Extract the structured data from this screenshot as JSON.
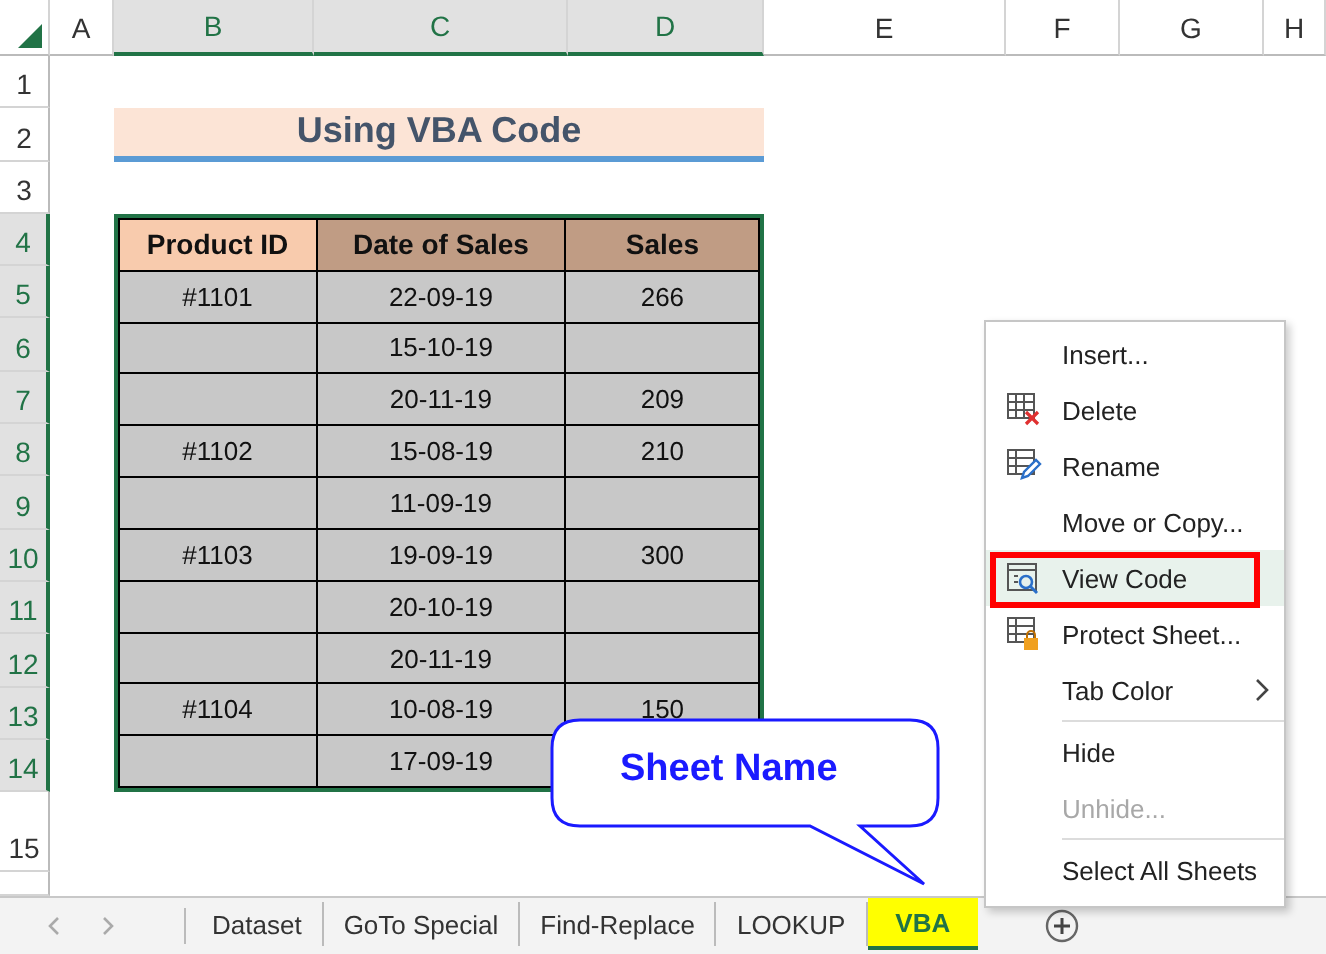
{
  "columns": [
    {
      "label": "A",
      "selected": false
    },
    {
      "label": "B",
      "selected": true
    },
    {
      "label": "C",
      "selected": true
    },
    {
      "label": "D",
      "selected": true
    },
    {
      "label": "E",
      "selected": false
    },
    {
      "label": "F",
      "selected": false
    },
    {
      "label": "G",
      "selected": false
    },
    {
      "label": "H",
      "selected": false
    }
  ],
  "rows": [
    {
      "label": "1",
      "selected": false
    },
    {
      "label": "2",
      "selected": false
    },
    {
      "label": "3",
      "selected": false
    },
    {
      "label": "4",
      "selected": true
    },
    {
      "label": "5",
      "selected": true
    },
    {
      "label": "6",
      "selected": true
    },
    {
      "label": "7",
      "selected": true
    },
    {
      "label": "8",
      "selected": true
    },
    {
      "label": "9",
      "selected": true
    },
    {
      "label": "10",
      "selected": true
    },
    {
      "label": "11",
      "selected": true
    },
    {
      "label": "12",
      "selected": true
    },
    {
      "label": "13",
      "selected": true
    },
    {
      "label": "14",
      "selected": true
    },
    {
      "label": "15",
      "selected": false
    }
  ],
  "title": "Using VBA Code",
  "table": {
    "columns": [
      "Product ID",
      "Date of Sales",
      "Sales"
    ],
    "rows": [
      {
        "product_id": "#1101",
        "date": "22-09-19",
        "sales": "266"
      },
      {
        "date": "15-10-19"
      },
      {
        "date": "20-11-19",
        "sales": "209"
      },
      {
        "product_id": "#1102",
        "date": "15-08-19",
        "sales": "210"
      },
      {
        "date": "11-09-19"
      },
      {
        "product_id": "#1103",
        "date": "19-09-19",
        "sales": "300"
      },
      {
        "date": "20-10-19"
      },
      {
        "date": "20-11-19"
      },
      {
        "product_id": "#1104",
        "date": "10-08-19",
        "sales": "150"
      },
      {
        "date": "17-09-19"
      }
    ]
  },
  "context_menu": [
    {
      "kind": "plain",
      "label": "Insert...",
      "selected": false,
      "disabled": false
    },
    {
      "kind": "delete",
      "label": "Delete",
      "selected": false,
      "disabled": false
    },
    {
      "kind": "rename",
      "label": "Rename",
      "selected": false,
      "disabled": false
    },
    {
      "kind": "plain",
      "label": "Move or Copy...",
      "selected": false,
      "disabled": false
    },
    {
      "kind": "view",
      "label": "View Code",
      "selected": true,
      "disabled": false,
      "annotated": true
    },
    {
      "kind": "protect",
      "label": "Protect Sheet...",
      "selected": false,
      "disabled": false
    },
    {
      "kind": "submenu",
      "label": "Tab Color",
      "selected": false,
      "disabled": false
    },
    {
      "kind": "separator"
    },
    {
      "kind": "plain",
      "label": "Hide",
      "selected": false,
      "disabled": false
    },
    {
      "kind": "plain",
      "label": "Unhide...",
      "selected": false,
      "disabled": true
    },
    {
      "kind": "separator"
    },
    {
      "kind": "plain",
      "label": "Select All Sheets",
      "selected": false,
      "disabled": false
    }
  ],
  "callout": "Sheet Name",
  "sheet_tabs": [
    {
      "label": "Dataset",
      "selected": false
    },
    {
      "label": "GoTo Special",
      "selected": false
    },
    {
      "label": "Find-Replace",
      "selected": false
    },
    {
      "label": "LOOKUP",
      "selected": false
    },
    {
      "label": "VBA",
      "selected": true
    }
  ]
}
